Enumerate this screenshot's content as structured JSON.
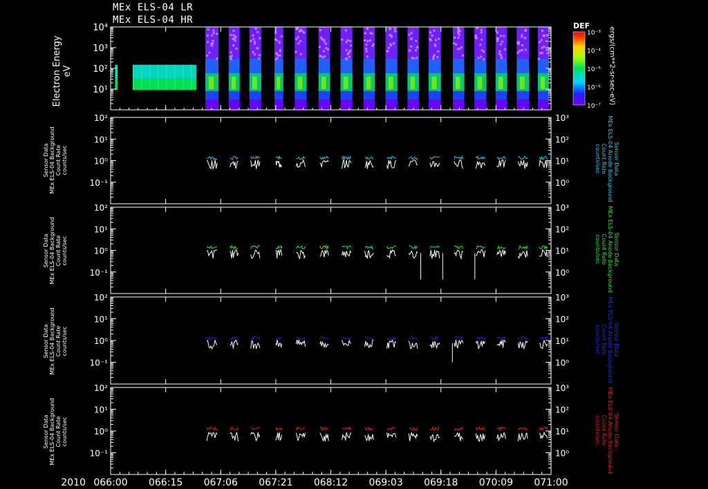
{
  "header": {
    "line1": "MEx ELS-04 LR",
    "line2": "MEx ELS-04 HR"
  },
  "colorbar": {
    "title": "DEF",
    "unit_label": "ergs/(cm**2-sr-sec-eV)",
    "tick_labels": [
      "10⁻³",
      "10⁻⁴",
      "10⁻⁵",
      "10⁻⁶",
      "10⁻⁷"
    ]
  },
  "colors": {
    "background": "#000000",
    "frame": "#ffffff",
    "cyan": "#22c8e6",
    "green": "#22e636",
    "blue": "#1e1ed2",
    "red": "#e61e1e"
  },
  "chart_data": [
    {
      "type": "heatmap",
      "name": "spectrogram",
      "ylabel": "Electron Energy",
      "yunit": "eV",
      "yscale": "log",
      "ylim": [
        1,
        10000
      ],
      "ytick_labels": [
        "10⁴",
        "10³",
        "10²",
        "10¹"
      ],
      "lr_blocks": [
        [
          0.01,
          0.016
        ],
        [
          0.05,
          0.195
        ]
      ],
      "hr_blocks": [
        [
          0.215,
          0.245
        ],
        [
          0.268,
          0.293
        ],
        [
          0.315,
          0.342
        ],
        [
          0.372,
          0.392
        ],
        [
          0.418,
          0.445
        ],
        [
          0.472,
          0.498
        ],
        [
          0.522,
          0.549
        ],
        [
          0.574,
          0.6
        ],
        [
          0.624,
          0.651
        ],
        [
          0.674,
          0.7
        ],
        [
          0.722,
          0.75
        ],
        [
          0.777,
          0.803
        ],
        [
          0.826,
          0.853
        ],
        [
          0.874,
          0.9
        ],
        [
          0.922,
          0.95
        ],
        [
          0.97,
          0.995
        ]
      ]
    },
    {
      "type": "line",
      "name": "bg-panel-1",
      "color": "cyan",
      "ylabel_left": [
        "Sensor Data",
        "MEx ELS-04 Background",
        "Count Rate",
        "counts/sec"
      ],
      "ylabel_right": [
        "Sensor Data",
        "MEx ELS-04 Anode Background",
        "Count Rate",
        "counts/sec"
      ],
      "yscale": "log",
      "ylim_left": [
        0.01,
        100
      ],
      "ylim_right": [
        0.1,
        1000
      ],
      "ytick_left": [
        "10²",
        "10¹",
        "10⁰",
        "10⁻¹"
      ],
      "ytick_right": [
        "10³",
        "10²",
        "10¹",
        "10⁰"
      ],
      "colored_level": 1.35,
      "white_level": 0.75,
      "dips": []
    },
    {
      "type": "line",
      "name": "bg-panel-2",
      "color": "green",
      "ylabel_left": [
        "Sensor Data",
        "MEx ELS-04 Background",
        "Count Rate",
        "counts/sec"
      ],
      "ylabel_right": [
        "Sensor Data",
        "MEx ELS-04 Anode Background",
        "Count Rate",
        "counts/sec"
      ],
      "yscale": "log",
      "ylim_left": [
        0.01,
        100
      ],
      "ylim_right": [
        0.1,
        1000
      ],
      "ytick_left": [
        "10²",
        "10¹",
        "10⁰",
        "10⁻¹"
      ],
      "ytick_right": [
        "10³",
        "10²",
        "10¹",
        "10⁰"
      ],
      "colored_level": 1.4,
      "white_level": 0.75,
      "dips": [
        [
          0.704,
          0.045
        ],
        [
          0.754,
          0.045
        ],
        [
          0.827,
          0.045
        ]
      ]
    },
    {
      "type": "line",
      "name": "bg-panel-3",
      "color": "blue",
      "ylabel_left": [
        "Sensor Data",
        "MEx ELS-04 Background",
        "Count Rate",
        "counts/sec"
      ],
      "ylabel_right": [
        "Sensor Data",
        "MEx ELS-04 Anode Background",
        "Count Rate",
        "counts/sec"
      ],
      "yscale": "log",
      "ylim_left": [
        0.01,
        100
      ],
      "ylim_right": [
        0.1,
        1000
      ],
      "ytick_left": [
        "10²",
        "10¹",
        "10⁰",
        "10⁻¹"
      ],
      "ytick_right": [
        "10³",
        "10²",
        "10¹",
        "10⁰"
      ],
      "colored_level": 1.3,
      "white_level": 0.75,
      "dips": [
        [
          0.776,
          0.1
        ]
      ]
    },
    {
      "type": "line",
      "name": "bg-panel-4",
      "color": "red",
      "ylabel_left": [
        "Sensor Data",
        "MEx ELS-04 Background",
        "Count Rate",
        "counts/sec"
      ],
      "ylabel_right": [
        "Sensor Data",
        "MEx ELS-04 Anode Background",
        "Count Rate",
        "counts/sec"
      ],
      "yscale": "log",
      "ylim_left": [
        0.01,
        100
      ],
      "ylim_right": [
        0.1,
        1000
      ],
      "ytick_left": [
        "10²",
        "10¹",
        "10⁰",
        "10⁻¹"
      ],
      "ytick_right": [
        "10³",
        "10²",
        "10¹",
        "10⁰"
      ],
      "colored_level": 1.3,
      "white_level": 0.6,
      "dips": []
    }
  ],
  "xaxis": {
    "year": "2010",
    "tick_labels": [
      "066:00",
      "066:15",
      "067:06",
      "067:21",
      "068:12",
      "069:03",
      "069:18",
      "070:09",
      "071:00"
    ]
  }
}
